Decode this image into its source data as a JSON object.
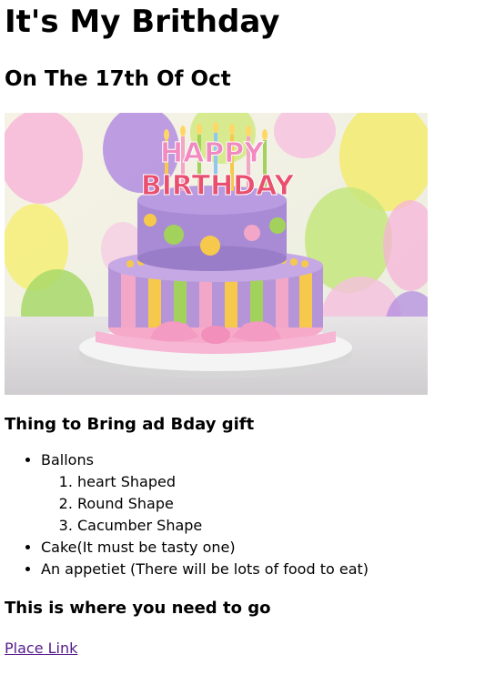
{
  "page": {
    "title": "It's My Brithday",
    "date_heading": "On The 17th Of Oct"
  },
  "image": {
    "cake_topper_text": "HAPPY BIRTHDAY",
    "colors": {
      "cake_purple": "#a98ad2",
      "cake_pink": "#f2a6c8",
      "cake_yellow": "#f4c84a",
      "cake_green": "#9fd05a",
      "plate": "#f1f1f1"
    }
  },
  "gifts": {
    "heading": "Thing to Bring ad Bday gift",
    "items": [
      {
        "label": "Ballons",
        "sub": [
          "heart Shaped",
          "Round Shape",
          "Cacumber Shape"
        ]
      },
      {
        "label": "Cake(It must be tasty one)"
      },
      {
        "label": "An appetiet (There will be lots of food to eat)"
      }
    ]
  },
  "location": {
    "heading": "This is where you need to go",
    "link_text": "Place Link"
  },
  "colors": {
    "link_visited": "#551a8b",
    "text": "#000000"
  }
}
